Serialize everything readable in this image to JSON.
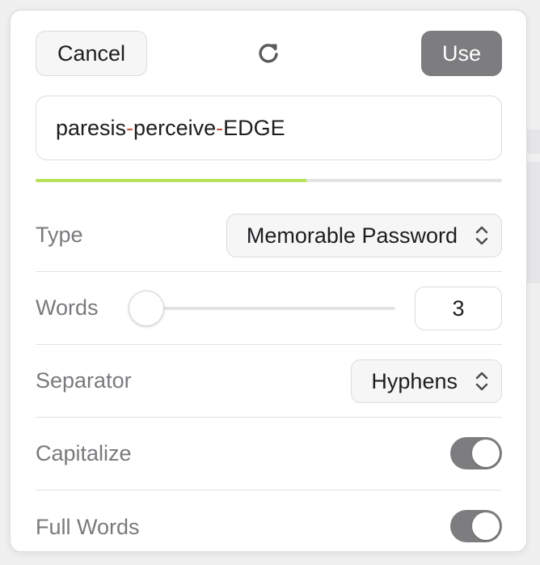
{
  "toolbar": {
    "cancel_label": "Cancel",
    "refresh_icon": "refresh-icon",
    "use_label": "Use"
  },
  "password": {
    "part1": "paresis",
    "sep1": "-",
    "part2": "perceive",
    "sep2": "-",
    "part3": "EDGE",
    "strength_fraction": 0.58,
    "strength_color": "#b9e35a",
    "separator_color": "#c8523a"
  },
  "settings": {
    "type": {
      "label": "Type",
      "value": "Memorable Password"
    },
    "words": {
      "label": "Words",
      "value": "3",
      "slider_fraction": 0.0
    },
    "separator": {
      "label": "Separator",
      "value": "Hyphens"
    },
    "capitalize": {
      "label": "Capitalize",
      "enabled": true
    },
    "full_words": {
      "label": "Full Words",
      "enabled": true
    }
  },
  "colors": {
    "accent_gray": "#7d7d7f",
    "label_gray": "#7a7a7e"
  }
}
